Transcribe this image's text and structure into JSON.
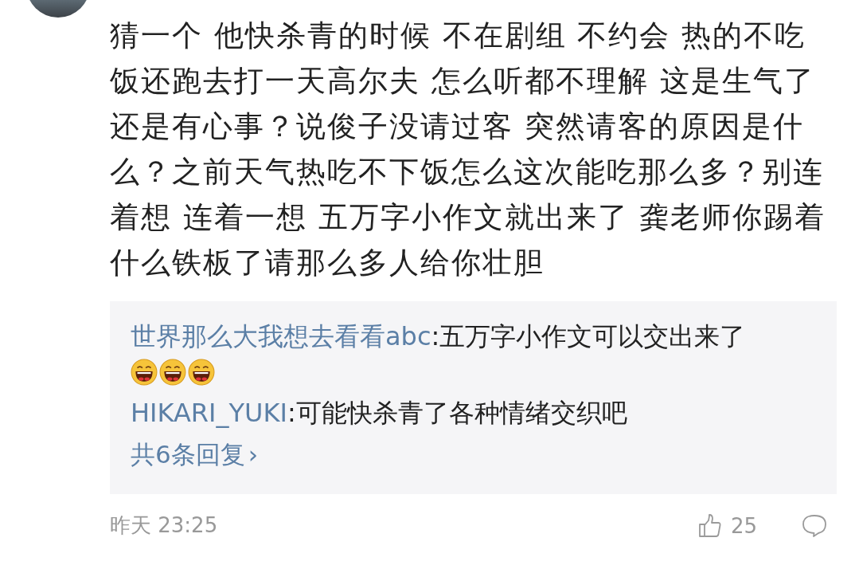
{
  "comment": {
    "text": "猜一个 他快杀青的时候 不在剧组 不约会 热的不吃饭还跑去打一天高尔夫 怎么听都不理解 这是生气了还是有心事？说俊子没请过客 突然请客的原因是什么？之前天气热吃不下饭怎么这次能吃那么多？别连着想 连着一想 五万字小作文就出来了 龚老师你踢着什么铁板了请那么多人给你壮胆"
  },
  "replies": [
    {
      "user": "世界那么大我想去看看abc",
      "text": ":五万字小作文可以交出来了",
      "emojis": [
        {
          "kind": "laugh"
        },
        {
          "kind": "laugh"
        },
        {
          "kind": "laugh"
        }
      ]
    },
    {
      "user": "HIKARI_YUKI",
      "text": ":可能快杀青了各种情绪交织吧"
    }
  ],
  "more_replies": "共6条回复",
  "more_arrow": "›",
  "footer": {
    "time": "昨天 23:25",
    "likes": "25"
  }
}
